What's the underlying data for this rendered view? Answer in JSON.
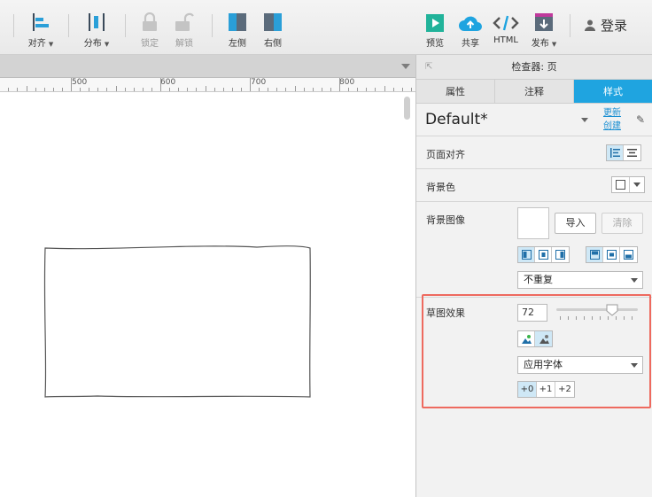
{
  "toolbar": {
    "align": "对齐",
    "distribute": "分布",
    "lock": "锁定",
    "unlock": "解锁",
    "left": "左侧",
    "right": "右侧",
    "preview": "预览",
    "share": "共享",
    "html": "HTML",
    "publish": "发布",
    "login": "登录"
  },
  "ruler": {
    "marks": [
      "500",
      "600",
      "700",
      "800"
    ]
  },
  "inspector": {
    "title": "检查器: 页",
    "tabs": [
      "属性",
      "注释",
      "样式"
    ],
    "active_tab": "样式",
    "style_name": "Default*",
    "update_link": "更新",
    "create_link": "创建",
    "page_align_label": "页面对齐",
    "bg_color_label": "背景色",
    "bg_image_label": "背景图像",
    "import_button": "导入",
    "clear_button": "清除",
    "repeat_value": "不重复",
    "sketch_label": "草图效果",
    "sketch_value": "72",
    "font_value": "应用字体",
    "stroke_options": [
      "+0",
      "+1",
      "+2"
    ]
  },
  "colors": {
    "accent": "#1fa4e0",
    "highlight": "#ee6a5f"
  }
}
